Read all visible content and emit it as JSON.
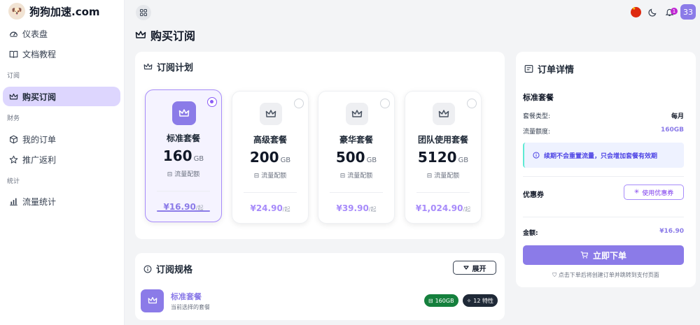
{
  "app": {
    "logo_text": "狗狗加速.com"
  },
  "sidebar": {
    "items": [
      {
        "label": "仪表盘",
        "icon": "gauge-icon"
      },
      {
        "label": "文档教程",
        "icon": "book-icon"
      },
      {
        "group": "订阅"
      },
      {
        "label": "购买订阅",
        "icon": "crown-icon",
        "active": true
      },
      {
        "group": "财务"
      },
      {
        "label": "我的订单",
        "icon": "box-icon"
      },
      {
        "label": "推广返利",
        "icon": "star-icon"
      },
      {
        "group": "统计"
      },
      {
        "label": "流量统计",
        "icon": "chart-icon"
      }
    ]
  },
  "topbar": {
    "notification_count": "1",
    "avatar_text": "33"
  },
  "page": {
    "title": "购买订阅"
  },
  "plans_card": {
    "title": "订阅计划",
    "quota_label": "流量配额",
    "per_label": "/起",
    "plans": [
      {
        "name": "标准套餐",
        "size": "160",
        "unit": "GB",
        "price": "¥16.90",
        "selected": true
      },
      {
        "name": "高级套餐",
        "size": "200",
        "unit": "GB",
        "price": "¥24.90",
        "selected": false
      },
      {
        "name": "豪华套餐",
        "size": "500",
        "unit": "GB",
        "price": "¥39.90",
        "selected": false
      },
      {
        "name": "团队使用套餐",
        "size": "5120",
        "unit": "GB",
        "price": "¥1,024.90",
        "selected": false
      }
    ]
  },
  "spec_card": {
    "title": "订阅规格",
    "expand_label": "展开",
    "plan_name": "标准套餐",
    "plan_sub": "当前选择的套餐",
    "pill_traffic": "160GB",
    "pill_features": "12 特性",
    "colors": {
      "traffic_pill": "#15803d",
      "features_pill": "#1f2937"
    }
  },
  "order_card": {
    "title": "订单详情",
    "plan_name": "标准套餐",
    "type_label": "套餐类型:",
    "type_value": "每月",
    "traffic_label": "流量额度:",
    "traffic_value": "160GB",
    "notice": "续期不会重置流量，只会增加套餐有效期",
    "coupon_label": "优惠券",
    "coupon_button": "使用优惠券",
    "total_label": "金额:",
    "total_value": "¥16.90",
    "order_button": "立即下单",
    "footnote": "点击下单后将创建订单并跳转到支付页面"
  },
  "colors": {
    "accent": "#8b7be8",
    "accent_light": "#ddd6fe"
  }
}
